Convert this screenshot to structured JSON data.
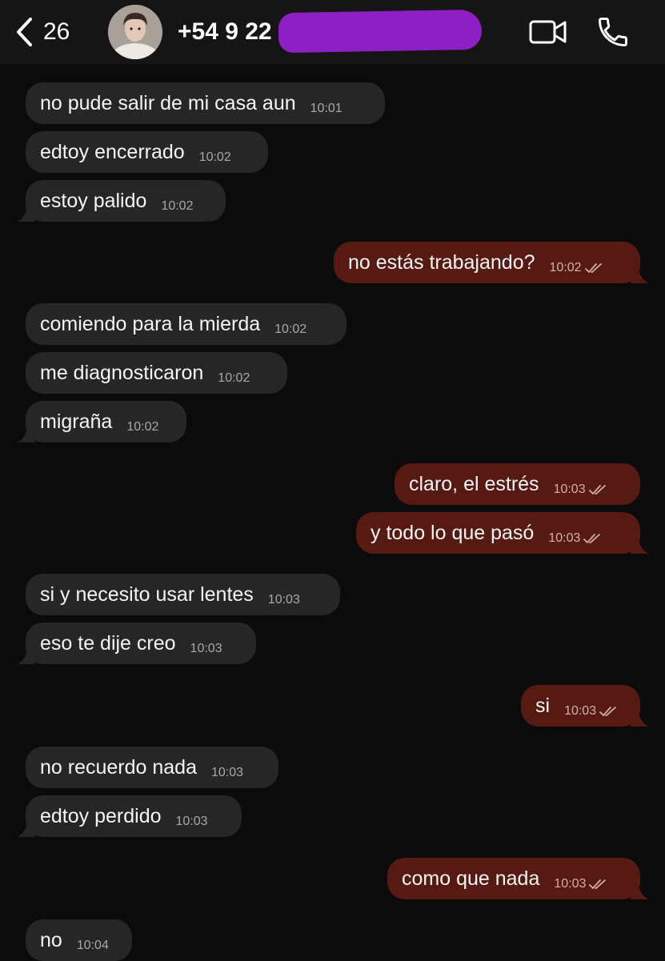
{
  "header": {
    "back_count": "26",
    "contact_name": "+54 9 22",
    "icons": {
      "back": "chevron-left-icon",
      "video": "video-camera-icon",
      "call": "phone-icon"
    }
  },
  "messages": [
    {
      "dir": "in",
      "text": "no pude salir de mi casa aun",
      "time": "10:01"
    },
    {
      "dir": "in",
      "text": "edtoy encerrado",
      "time": "10:02"
    },
    {
      "dir": "in",
      "text": "estoy palido",
      "time": "10:02"
    },
    {
      "dir": "out",
      "text": "no estás trabajando?",
      "time": "10:02"
    },
    {
      "dir": "in",
      "text": "comiendo para la mierda",
      "time": "10:02"
    },
    {
      "dir": "in",
      "text": "me diagnosticaron",
      "time": "10:02"
    },
    {
      "dir": "in",
      "text": "migraña",
      "time": "10:02"
    },
    {
      "dir": "out",
      "text": "claro, el estrés",
      "time": "10:03"
    },
    {
      "dir": "out",
      "text": "y todo lo que pasó",
      "time": "10:03"
    },
    {
      "dir": "in",
      "text": "si y necesito usar lentes",
      "time": "10:03"
    },
    {
      "dir": "in",
      "text": "eso te dije creo",
      "time": "10:03"
    },
    {
      "dir": "out",
      "text": "si",
      "time": "10:03"
    },
    {
      "dir": "in",
      "text": "no recuerdo nada",
      "time": "10:03"
    },
    {
      "dir": "in",
      "text": "edtoy perdido",
      "time": "10:03"
    },
    {
      "dir": "out",
      "text": "como que nada",
      "time": "10:03"
    },
    {
      "dir": "in",
      "text": "no",
      "time": "10:04"
    }
  ],
  "colors": {
    "background": "#0b0b0b",
    "header": "#151515",
    "incoming_bubble": "#262626",
    "outgoing_bubble": "#561a12",
    "redaction": "#8e1fc4"
  }
}
